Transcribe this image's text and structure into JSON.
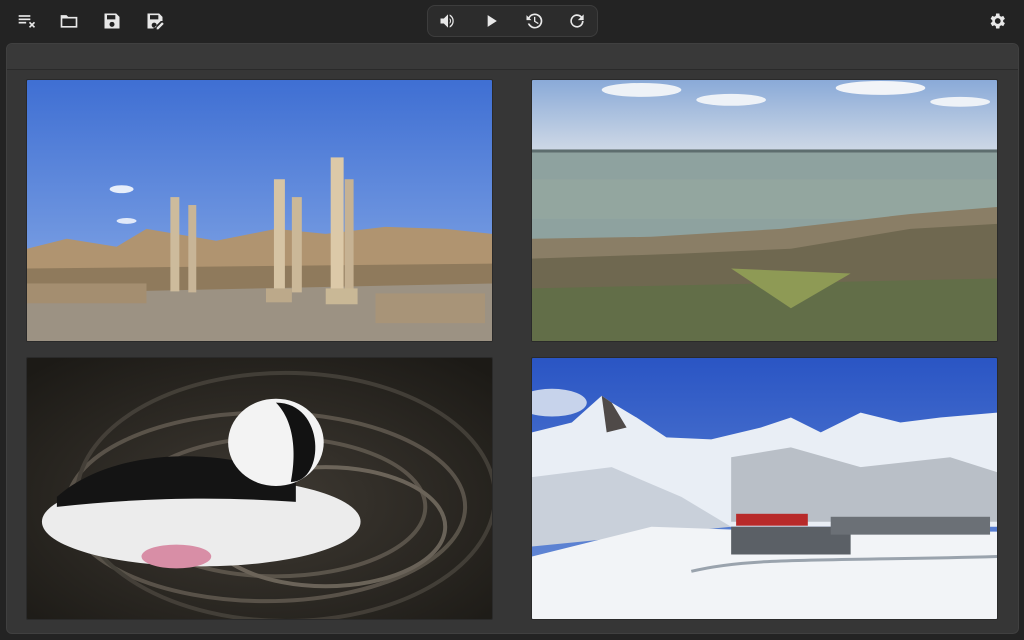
{
  "toolbar": {
    "left_buttons": [
      {
        "icon": "clear-playlist-icon"
      },
      {
        "icon": "folder-open-icon"
      },
      {
        "icon": "save-icon"
      },
      {
        "icon": "save-as-icon"
      }
    ],
    "player_buttons": [
      {
        "icon": "volume-icon"
      },
      {
        "icon": "play-icon"
      },
      {
        "icon": "history-icon"
      },
      {
        "icon": "reload-icon"
      }
    ],
    "right_buttons": [
      {
        "icon": "settings-icon"
      }
    ]
  },
  "grid": {
    "tiles": [
      {
        "subject": "ancient-ruins-columns"
      },
      {
        "subject": "lake-shore-forest"
      },
      {
        "subject": "bufflehead-duck-water"
      },
      {
        "subject": "matterhorn-snow-train"
      }
    ]
  },
  "colors": {
    "background": "#232323",
    "panel": "#363636",
    "icon": "#e8e8e8"
  }
}
